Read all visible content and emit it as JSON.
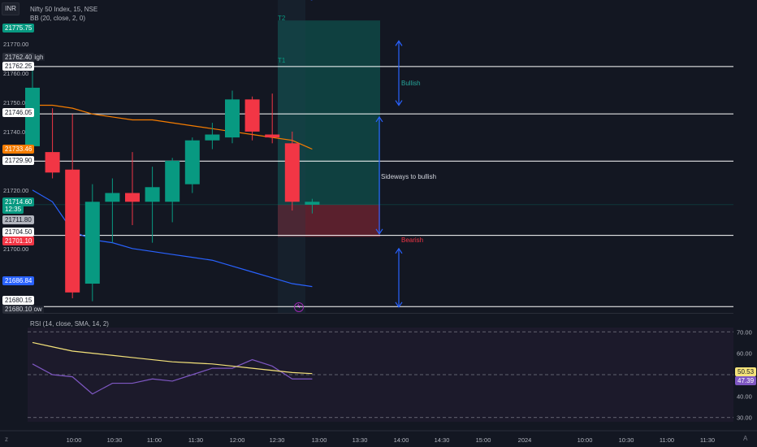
{
  "header": {
    "currency_button": "INR",
    "symbol_title": "Nifty 50 Index, 15, NSE",
    "bb_indicator": "BB (20, close, 2, 0)",
    "rsi_indicator": "RSI (14, close, SMA, 14, 2)"
  },
  "annotations": {
    "t2": "T2",
    "t1": "T1",
    "bullish": "Bullish",
    "sideways": "Sideways to bullish",
    "bearish": "Bearish",
    "high_label": "High",
    "low_label": "Low"
  },
  "price_tags": [
    {
      "value": "21775.75",
      "bg": "#089981",
      "fg": "#ffffff"
    },
    {
      "value": "21762.40",
      "bg": "#2a2e39",
      "fg": "#d1d4dc"
    },
    {
      "value": "21762.25",
      "bg": "#ffffff",
      "fg": "#131722"
    },
    {
      "value": "21746.05",
      "bg": "#ffffff",
      "fg": "#131722"
    },
    {
      "value": "21733.46",
      "bg": "#f57c00",
      "fg": "#ffffff"
    },
    {
      "value": "21729.90",
      "bg": "#ffffff",
      "fg": "#131722"
    },
    {
      "value": "21714.60",
      "bg": "#089981",
      "fg": "#ffffff"
    },
    {
      "value": "12:35",
      "bg": "#089981",
      "fg": "#ffffff"
    },
    {
      "value": "21711.80",
      "bg": "#b2b5be",
      "fg": "#131722"
    },
    {
      "value": "21704.50",
      "bg": "#ffffff",
      "fg": "#131722"
    },
    {
      "value": "21701.10",
      "bg": "#f23645",
      "fg": "#ffffff"
    },
    {
      "value": "21686.84",
      "bg": "#2962ff",
      "fg": "#ffffff"
    },
    {
      "value": "21680.15",
      "bg": "#ffffff",
      "fg": "#131722"
    },
    {
      "value": "21680.10",
      "bg": "#2a2e39",
      "fg": "#d1d4dc"
    }
  ],
  "rsi_tags": [
    {
      "value": "50.53",
      "bg": "#f5e37a",
      "fg": "#131722"
    },
    {
      "value": "47.39",
      "bg": "#7e57c2",
      "fg": "#ffffff"
    }
  ],
  "chart_data": {
    "type": "candlestick",
    "y_ticks": [
      "21770.00",
      "21760.00",
      "21750.00",
      "21740.00",
      "21730.00",
      "21720.00",
      "21710.00",
      "21700.00",
      "21690.00"
    ],
    "ylim": [
      21678,
      21785
    ],
    "x_ticks": [
      "10:00",
      "10:30",
      "11:00",
      "11:30",
      "12:00",
      "12:30",
      "13:00",
      "13:30",
      "14:00",
      "14:30",
      "15:00",
      "2024",
      "10:00",
      "10:30",
      "11:00",
      "11:30"
    ],
    "candles": [
      {
        "time": "09:15",
        "open": 21735,
        "high": 21764,
        "low": 21733,
        "close": 21755
      },
      {
        "time": "09:30",
        "open": 21733,
        "high": 21748,
        "low": 21724,
        "close": 21726
      },
      {
        "time": "09:45",
        "open": 21727,
        "high": 21746,
        "low": 21683,
        "close": 21685
      },
      {
        "time": "10:00",
        "open": 21688,
        "high": 21722,
        "low": 21682,
        "close": 21716
      },
      {
        "time": "10:15",
        "open": 21716,
        "high": 21724,
        "low": 21702,
        "close": 21719
      },
      {
        "time": "10:30",
        "open": 21719,
        "high": 21733,
        "low": 21708,
        "close": 21716
      },
      {
        "time": "10:45",
        "open": 21716,
        "high": 21728,
        "low": 21702,
        "close": 21721
      },
      {
        "time": "11:00",
        "open": 21716,
        "high": 21731,
        "low": 21709,
        "close": 21730
      },
      {
        "time": "11:15",
        "open": 21722,
        "high": 21738,
        "low": 21719,
        "close": 21737
      },
      {
        "time": "11:30",
        "open": 21737,
        "high": 21743,
        "low": 21734,
        "close": 21739
      },
      {
        "time": "11:45",
        "open": 21738,
        "high": 21754,
        "low": 21736,
        "close": 21751
      },
      {
        "time": "12:00",
        "open": 21751,
        "high": 21752,
        "low": 21737,
        "close": 21740
      },
      {
        "time": "12:15",
        "open": 21739,
        "high": 21753,
        "low": 21736,
        "close": 21738
      },
      {
        "time": "12:30",
        "open": 21736,
        "high": 21740,
        "low": 21713,
        "close": 21716
      },
      {
        "time": "12:45",
        "open": 21715,
        "high": 21717,
        "low": 21712,
        "close": 21716
      }
    ],
    "bb_upper": [
      21862,
      21854,
      21846,
      21838,
      21830,
      21822,
      21812,
      21803,
      21796,
      21792,
      21790,
      21789,
      21789,
      21787,
      21785
    ],
    "bb_basis": [
      21749,
      21749,
      21748,
      21746,
      21745,
      21744,
      21744,
      21743,
      21742,
      21741,
      21740,
      21739,
      21738,
      21737,
      21734
    ],
    "bb_lower": [
      21720,
      21716,
      21706,
      21703,
      21702,
      21700,
      21699,
      21698,
      21697,
      21696,
      21694,
      21692,
      21690,
      21688,
      21687
    ],
    "horizontal_levels": [
      21762.25,
      21746.05,
      21729.9,
      21704.5,
      21680.15
    ],
    "long_position": {
      "entry": 21715,
      "target": 21778,
      "stop": 21704
    },
    "rsi": {
      "ylim": [
        28,
        72
      ],
      "y_ticks": [
        "70.00",
        "60.00",
        "50.00",
        "40.00",
        "30.00"
      ],
      "values": [
        55,
        50,
        49,
        41,
        46,
        46,
        48,
        47,
        50,
        53,
        53,
        57,
        54,
        48,
        48
      ],
      "sma": [
        65,
        63,
        61,
        60,
        59,
        58,
        57,
        56,
        55.5,
        55,
        54,
        53,
        52,
        51,
        50.5
      ],
      "bands": [
        70,
        50,
        30
      ]
    }
  }
}
